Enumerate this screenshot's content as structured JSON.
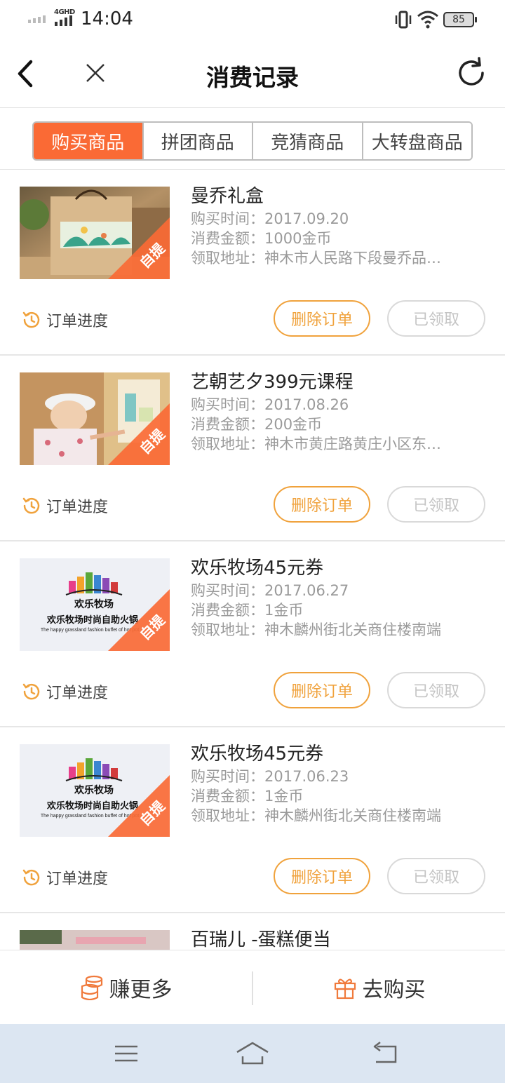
{
  "status_bar": {
    "network": "4GHD",
    "time": "14:04",
    "battery": "85"
  },
  "nav": {
    "title": "消费记录"
  },
  "tabs": [
    {
      "label": "购买商品",
      "active": true
    },
    {
      "label": "拼团商品",
      "active": false
    },
    {
      "label": "竞猜商品",
      "active": false
    },
    {
      "label": "大转盘商品",
      "active": false
    }
  ],
  "orders": [
    {
      "title": "曼乔礼盒",
      "purchase_time": "购买时间：2017.09.20",
      "amount": "消费金额：1000金币",
      "address": "领取地址：神木市人民路下段曼乔品…",
      "tag": "自提",
      "progress_label": "订单进度",
      "delete_label": "删除订单",
      "status_label": "已领取"
    },
    {
      "title": "艺朝艺夕399元课程",
      "purchase_time": "购买时间：2017.08.26",
      "amount": "消费金额：200金币",
      "address": "领取地址：神木市黄庄路黄庄小区东…",
      "tag": "自提",
      "progress_label": "订单进度",
      "delete_label": "删除订单",
      "status_label": "已领取"
    },
    {
      "title": "欢乐牧场45元券",
      "purchase_time": "购买时间：2017.06.27",
      "amount": "消费金额：1金币",
      "address": "领取地址：神木麟州街北关商住楼南端",
      "tag": "自提",
      "progress_label": "订单进度",
      "delete_label": "删除订单",
      "status_label": "已领取",
      "logo_text": "欢乐牧场",
      "logo_line": "欢乐牧场时尚自助火锅",
      "logo_en": "The happy grassland fashion buffet of hot pot"
    },
    {
      "title": "欢乐牧场45元券",
      "purchase_time": "购买时间：2017.06.23",
      "amount": "消费金额：1金币",
      "address": "领取地址：神木麟州街北关商住楼南端",
      "tag": "自提",
      "progress_label": "订单进度",
      "delete_label": "删除订单",
      "status_label": "已领取",
      "logo_text": "欢乐牧场",
      "logo_line": "欢乐牧场时尚自助火锅",
      "logo_en": "The happy grassland fashion buffet of hot pot"
    },
    {
      "title": "百瑞儿 -蛋糕便当"
    }
  ],
  "actions": {
    "earn_more": "赚更多",
    "go_buy": "去购买"
  },
  "colors": {
    "accent": "#fa6a35",
    "button_orange": "#f0a23c",
    "disabled": "#c4c4c4",
    "system_nav": "#dce6f2"
  },
  "icons": {
    "back": "back-arrow-icon",
    "close": "close-icon",
    "refresh": "refresh-icon",
    "progress": "clock-history-icon",
    "earn": "coin-stack-icon",
    "buy": "gift-icon"
  }
}
